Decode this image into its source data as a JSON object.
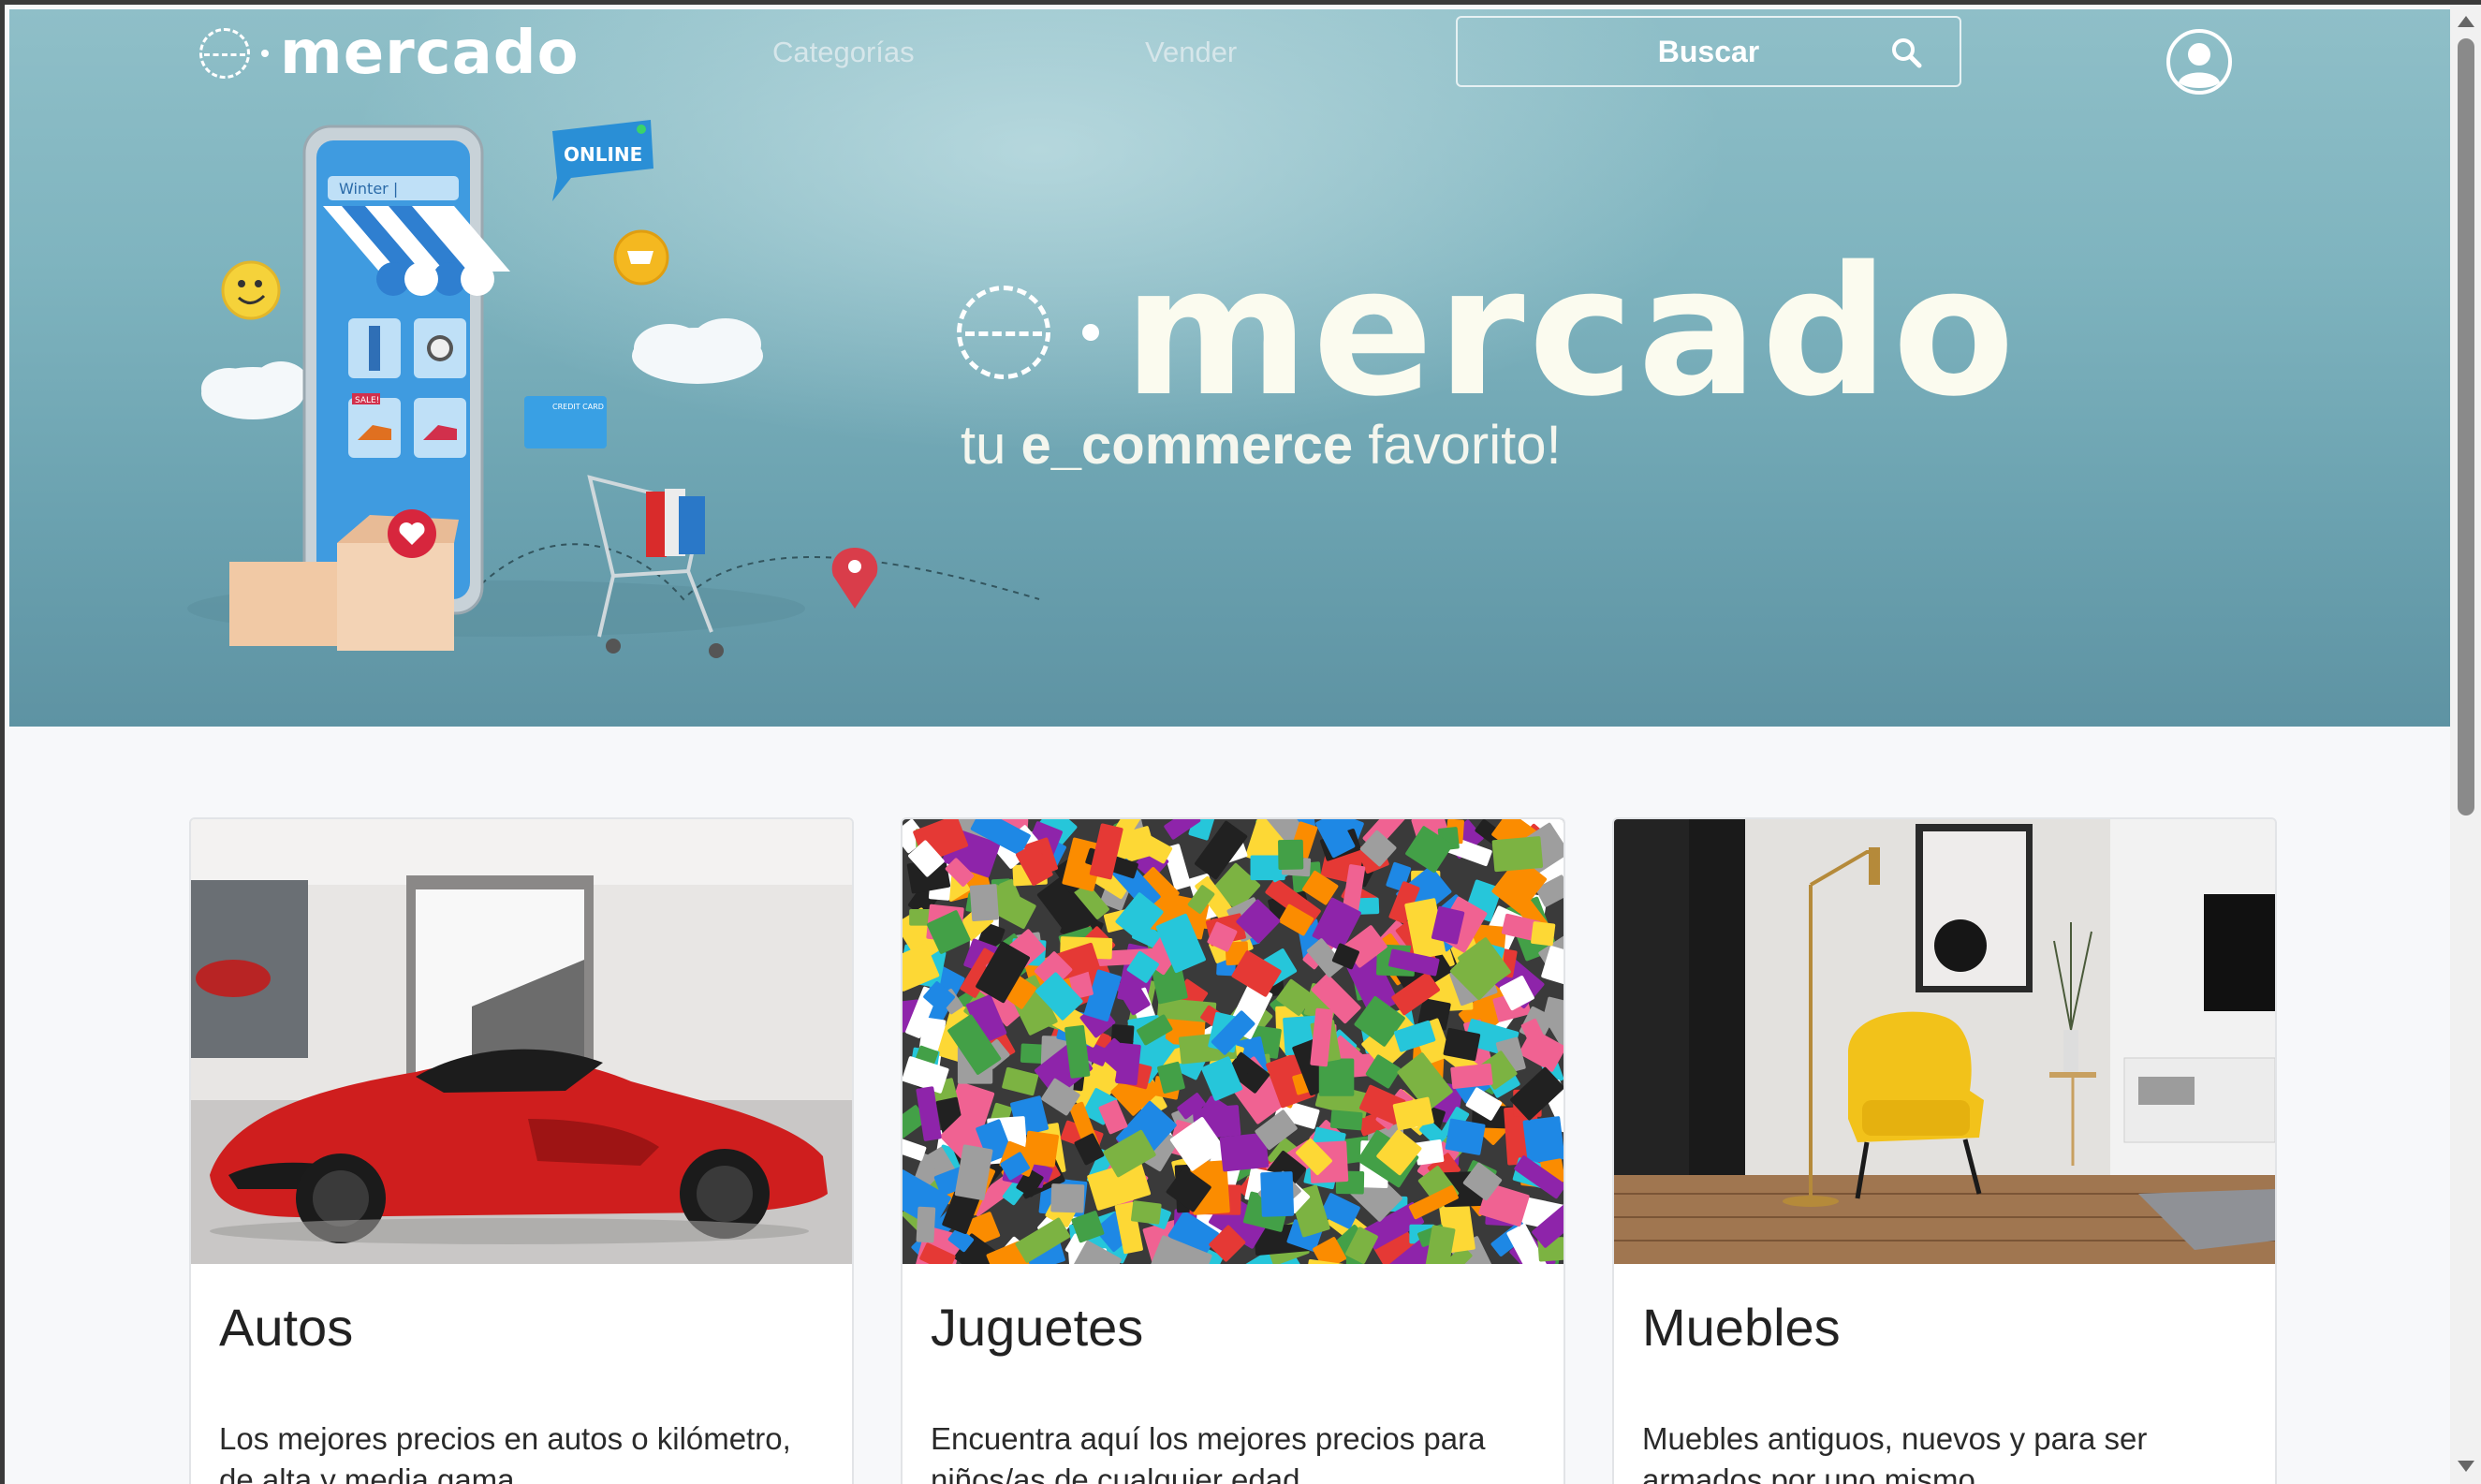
{
  "nav": {
    "logo_text": "mercado",
    "links": [
      {
        "label": "Categorías"
      },
      {
        "label": "Vender"
      }
    ],
    "search_label": "Buscar",
    "search_icon": "search-icon",
    "account_icon": "user-circle-icon"
  },
  "hero": {
    "brand": "mercado",
    "tagline_pre": "tu ",
    "tagline_bold": "e_commerce",
    "tagline_post": " favorito!",
    "illustration": {
      "search_text": "Winter |",
      "bubble_text": "ONLINE",
      "sale_text": "SALE!",
      "card_text": "CREDIT CARD"
    }
  },
  "cards": [
    {
      "title": "Autos",
      "text": "Los mejores precios en autos o kilómetro, de alta y media gama"
    },
    {
      "title": "Juguetes",
      "text": "Encuentra aquí los mejores precios para niños/as de cualquier edad"
    },
    {
      "title": "Muebles",
      "text": "Muebles antiguos, nuevos y para ser armados por uno mismo"
    }
  ],
  "colors": {
    "hero_bg": "#78aeba",
    "brand_text": "#fbfbef",
    "page_bg": "#f7f8fa"
  }
}
